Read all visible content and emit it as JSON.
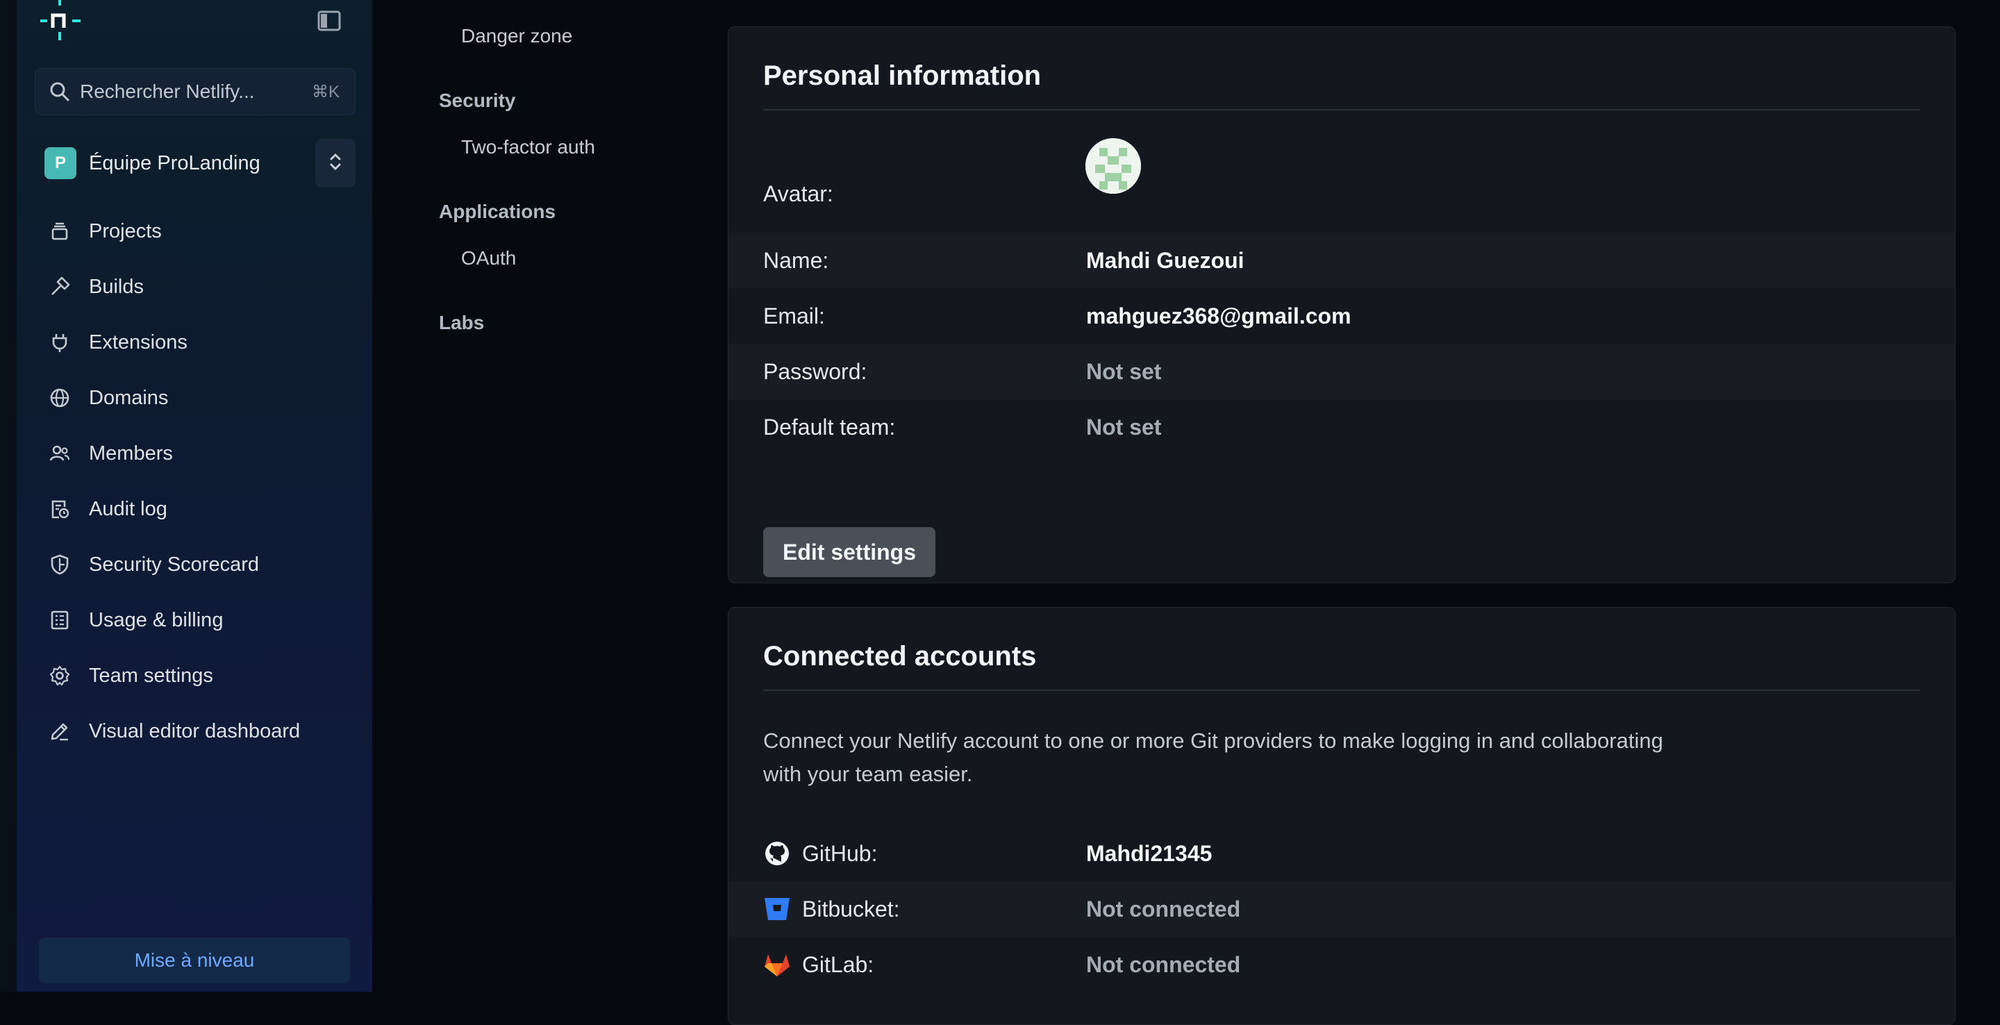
{
  "sidebar": {
    "search": {
      "label": "Rechercher Netlify...",
      "shortcut": "⌘K"
    },
    "team": {
      "initial": "P",
      "name": "Équipe ProLanding"
    },
    "items": [
      {
        "label": "Projects",
        "icon": "projects-icon"
      },
      {
        "label": "Builds",
        "icon": "hammer-icon"
      },
      {
        "label": "Extensions",
        "icon": "plug-icon"
      },
      {
        "label": "Domains",
        "icon": "globe-icon"
      },
      {
        "label": "Members",
        "icon": "members-icon"
      },
      {
        "label": "Audit log",
        "icon": "audit-log-icon"
      },
      {
        "label": "Security Scorecard",
        "icon": "shield-icon"
      },
      {
        "label": "Usage & billing",
        "icon": "receipt-icon"
      },
      {
        "label": "Team settings",
        "icon": "gear-icon"
      },
      {
        "label": "Visual editor dashboard",
        "icon": "pencil-icon"
      }
    ],
    "upgrade_label": "Mise à niveau"
  },
  "subnav": {
    "danger_zone": "Danger zone",
    "security_heading": "Security",
    "two_factor": "Two-factor auth",
    "applications_heading": "Applications",
    "oauth": "OAuth",
    "labs_heading": "Labs"
  },
  "personal": {
    "title": "Personal information",
    "avatar_label": "Avatar:",
    "name_label": "Name:",
    "name_value": "Mahdi Guezoui",
    "email_label": "Email:",
    "email_value": "mahguez368@gmail.com",
    "password_label": "Password:",
    "password_value": "Not set",
    "default_team_label": "Default team:",
    "default_team_value": "Not set",
    "edit_button": "Edit settings"
  },
  "connected": {
    "title": "Connected accounts",
    "description": "Connect your Netlify account to one or more Git providers to make logging in and collaborating with your team easier.",
    "github_label": "GitHub:",
    "github_value": "Mahdi21345",
    "bitbucket_label": "Bitbucket:",
    "bitbucket_value": "Not connected",
    "gitlab_label": "GitLab:",
    "gitlab_value": "Not connected"
  },
  "colors": {
    "accent_link": "#6fa9ff",
    "team_avatar": "#47b9b3",
    "netlify_teal": "#32e6e2"
  }
}
